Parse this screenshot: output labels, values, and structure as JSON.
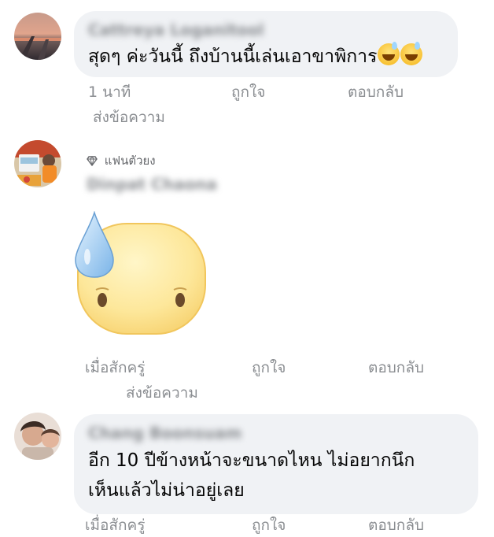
{
  "comments": [
    {
      "author": "Cattreya Loganitool",
      "text": "สุดๆ ค่ะวันนี้ ถึงบ้านนี้เล่นเอาขาพิการ",
      "emoji": [
        "grinning-sweat-emoji",
        "grinning-sweat-emoji"
      ],
      "time": "1 นาที",
      "like": "ถูกใจ",
      "reply": "ตอบกลับ",
      "message": "ส่งข้อความ"
    },
    {
      "badge": "แฟนตัวยง",
      "author": "Dinpat Chaona",
      "sticker": "sweat-drop-face-sticker",
      "time": "เมื่อสักครู่",
      "like": "ถูกใจ",
      "reply": "ตอบกลับ",
      "message": "ส่งข้อความ"
    },
    {
      "author": "Chang Boonsuam",
      "text_lines": [
        "อีก 10 ปีข้างหน้าจะขนาดไหน ไม่อยากนึก",
        "เห็นแล้วไม่น่าอยู่เลย"
      ],
      "time": "เมื่อสักครู่",
      "like": "ถูกใจ",
      "reply": "ตอบกลับ"
    }
  ]
}
